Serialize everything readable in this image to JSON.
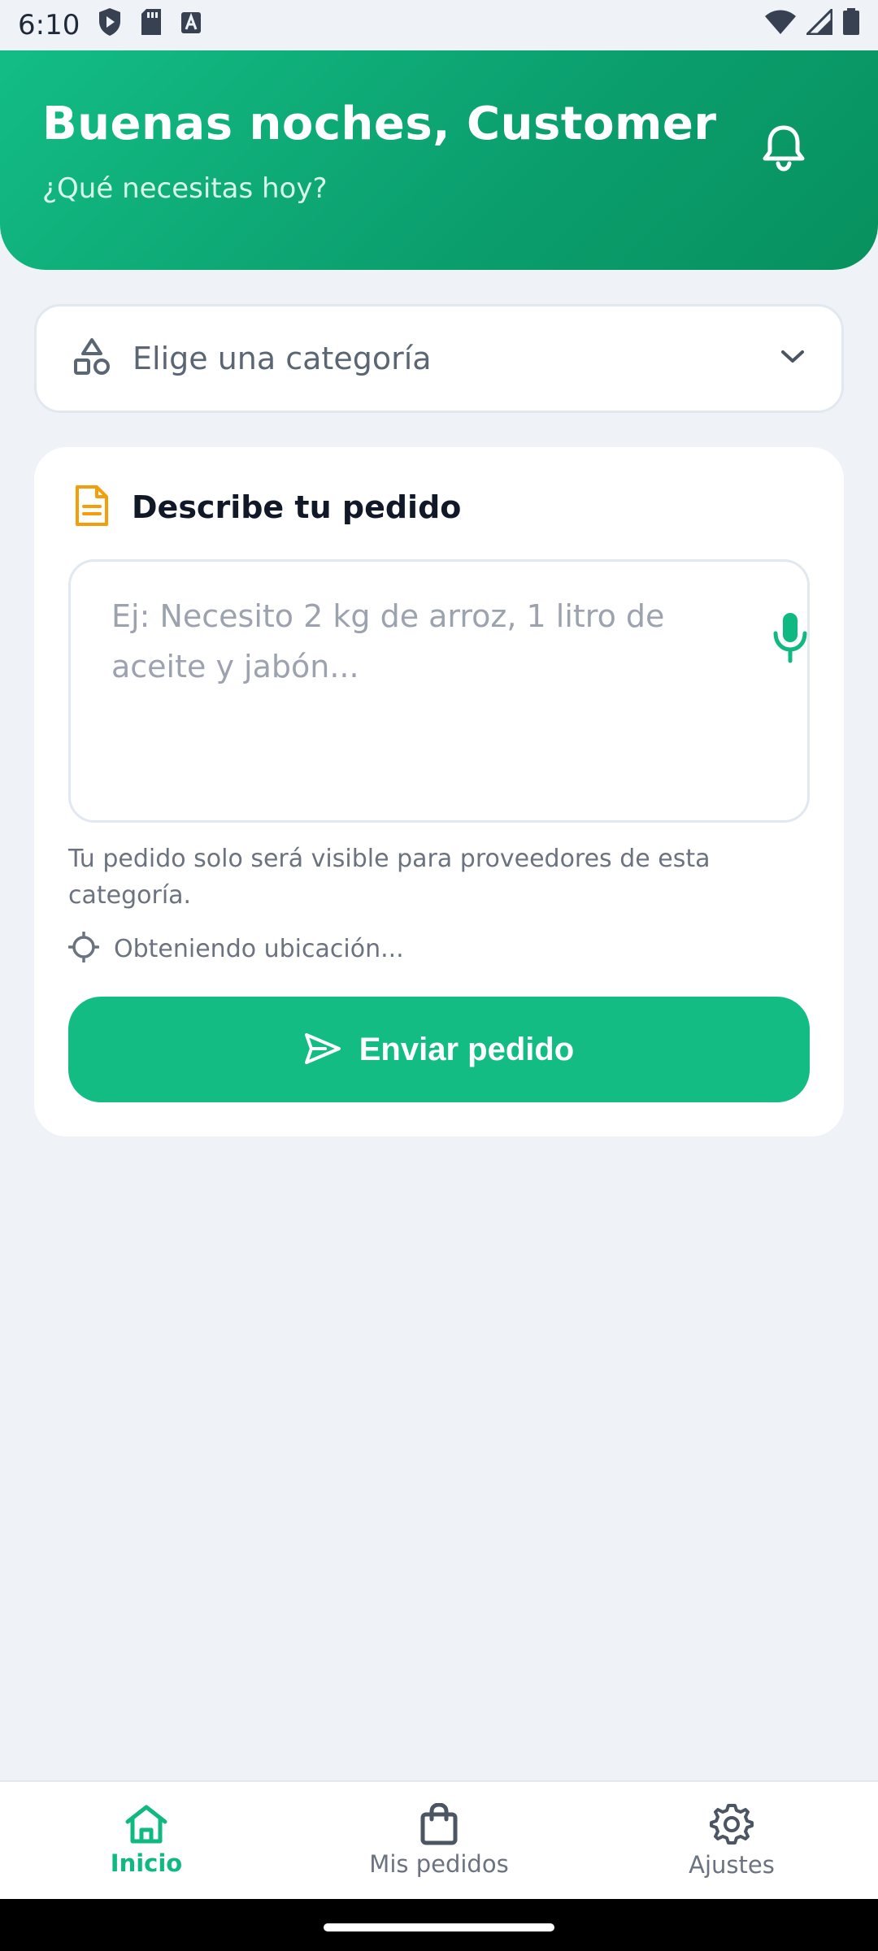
{
  "status_bar": {
    "time": "6:10"
  },
  "header": {
    "greeting": "Buenas noches, Customer",
    "subtitle": "¿Qué necesitas hoy?"
  },
  "category": {
    "placeholder": "Elige una categoría"
  },
  "order_card": {
    "title": "Describe tu pedido",
    "placeholder": "Ej: Necesito 2 kg de arroz, 1 litro de aceite y jabón...",
    "value": "",
    "visibility_note": "Tu pedido solo será visible para proveedores de esta categoría.",
    "location_status": "Obteniendo ubicación...",
    "send_label": "Enviar pedido"
  },
  "bottom_nav": {
    "items": [
      {
        "label": "Inicio",
        "icon": "home-icon",
        "active": true
      },
      {
        "label": "Mis pedidos",
        "icon": "shopping-bag-icon",
        "active": false
      },
      {
        "label": "Ajustes",
        "icon": "gear-icon",
        "active": false
      }
    ]
  },
  "colors": {
    "accent": "#12bc82",
    "header_gradient_start": "#13bd85",
    "header_gradient_end": "#07915f",
    "document_icon": "#f59e0b",
    "background": "#eff3f8"
  }
}
